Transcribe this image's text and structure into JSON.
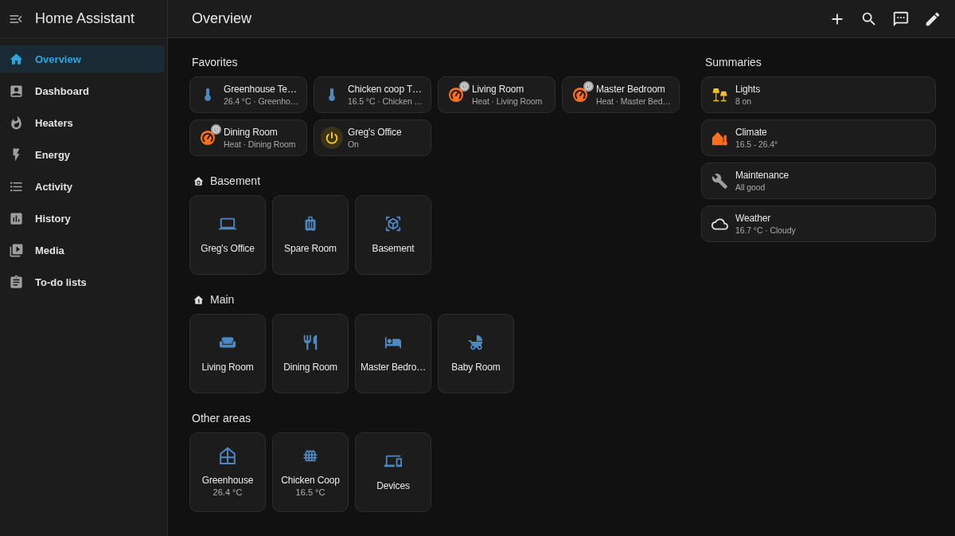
{
  "sidebar": {
    "title": "Home Assistant",
    "items": [
      {
        "label": "Overview",
        "selected": true
      },
      {
        "label": "Dashboard",
        "selected": false
      },
      {
        "label": "Heaters",
        "selected": false
      },
      {
        "label": "Energy",
        "selected": false
      },
      {
        "label": "Activity",
        "selected": false
      },
      {
        "label": "History",
        "selected": false
      },
      {
        "label": "Media",
        "selected": false
      },
      {
        "label": "To-do lists",
        "selected": false
      }
    ]
  },
  "header": {
    "title": "Overview"
  },
  "favorites": {
    "title": "Favorites",
    "tiles": [
      {
        "kind": "sensor",
        "name": "Greenhouse Te…",
        "state": "26.4 °C · Greenho…"
      },
      {
        "kind": "sensor",
        "name": "Chicken coop T…",
        "state": "16.5 °C · Chicken …"
      },
      {
        "kind": "climate",
        "name": "Living Room",
        "state": "Heat · Living Room"
      },
      {
        "kind": "climate",
        "name": "Master Bedroom",
        "state": "Heat · Master Bed…"
      },
      {
        "kind": "climate",
        "name": "Dining Room",
        "state": "Heat · Dining Room"
      },
      {
        "kind": "switch",
        "name": "Greg's Office",
        "state": "On",
        "on": true
      }
    ]
  },
  "areas": [
    {
      "title": "Basement",
      "kind": "floor",
      "cards": [
        {
          "name": "Greg's Office"
        },
        {
          "name": "Spare Room"
        },
        {
          "name": "Basement"
        }
      ]
    },
    {
      "title": "Main",
      "kind": "floor",
      "cards": [
        {
          "name": "Living Room"
        },
        {
          "name": "Dining Room"
        },
        {
          "name": "Master Bedro…"
        },
        {
          "name": "Baby Room"
        }
      ]
    },
    {
      "title": "Other areas",
      "kind": "other",
      "cards": [
        {
          "name": "Greenhouse",
          "reading": "26.4 °C"
        },
        {
          "name": "Chicken Coop",
          "reading": "16.5 °C"
        },
        {
          "name": "Devices"
        }
      ]
    }
  ],
  "summaries": {
    "title": "Summaries",
    "cards": [
      {
        "name": "Lights",
        "state": "8 on"
      },
      {
        "name": "Climate",
        "state": "16.5 - 26.4°"
      },
      {
        "name": "Maintenance",
        "state": "All good"
      },
      {
        "name": "Weather",
        "state": "16.7 °C · Cloudy"
      }
    ]
  }
}
